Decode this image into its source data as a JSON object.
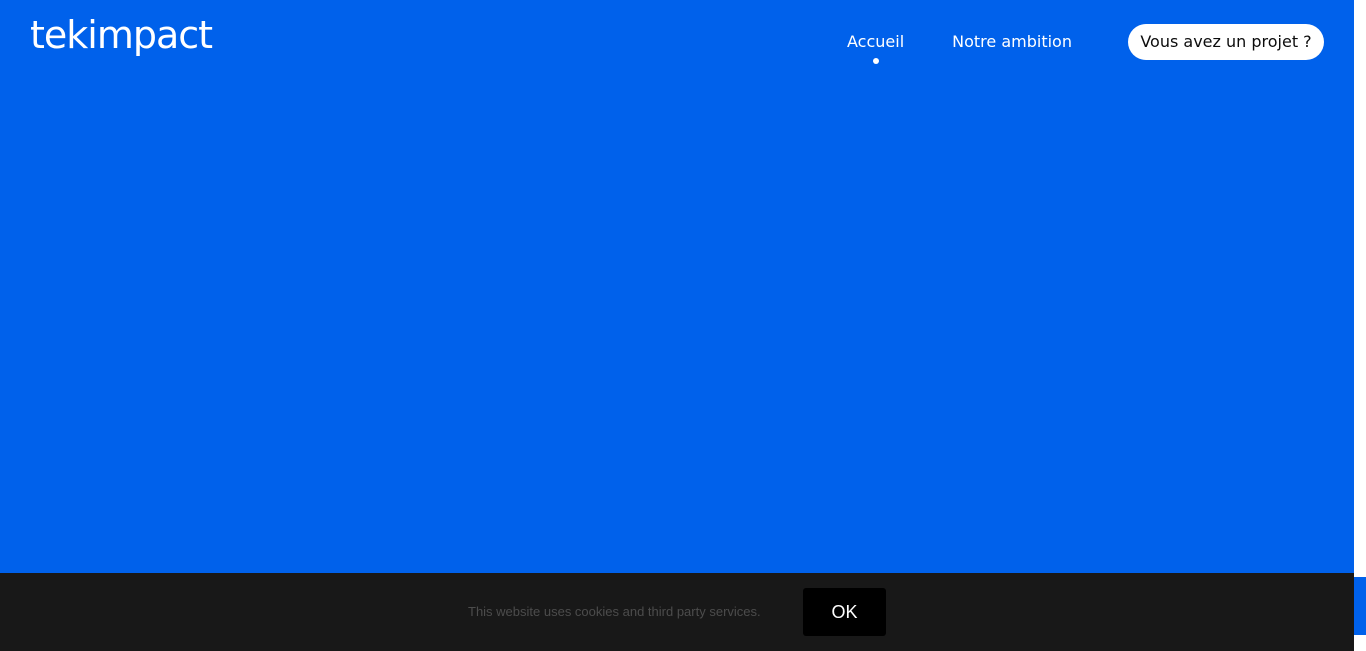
{
  "brand": {
    "logo_text": "tekimpact",
    "background_color": "#0061EB"
  },
  "nav": {
    "items": [
      {
        "label": "Accueil",
        "active": true
      },
      {
        "label": "Notre ambition",
        "active": false
      }
    ],
    "cta_label": "Vous avez un projet ?"
  },
  "cookie_banner": {
    "message": "This website uses cookies and third party services.",
    "ok_label": "OK"
  }
}
